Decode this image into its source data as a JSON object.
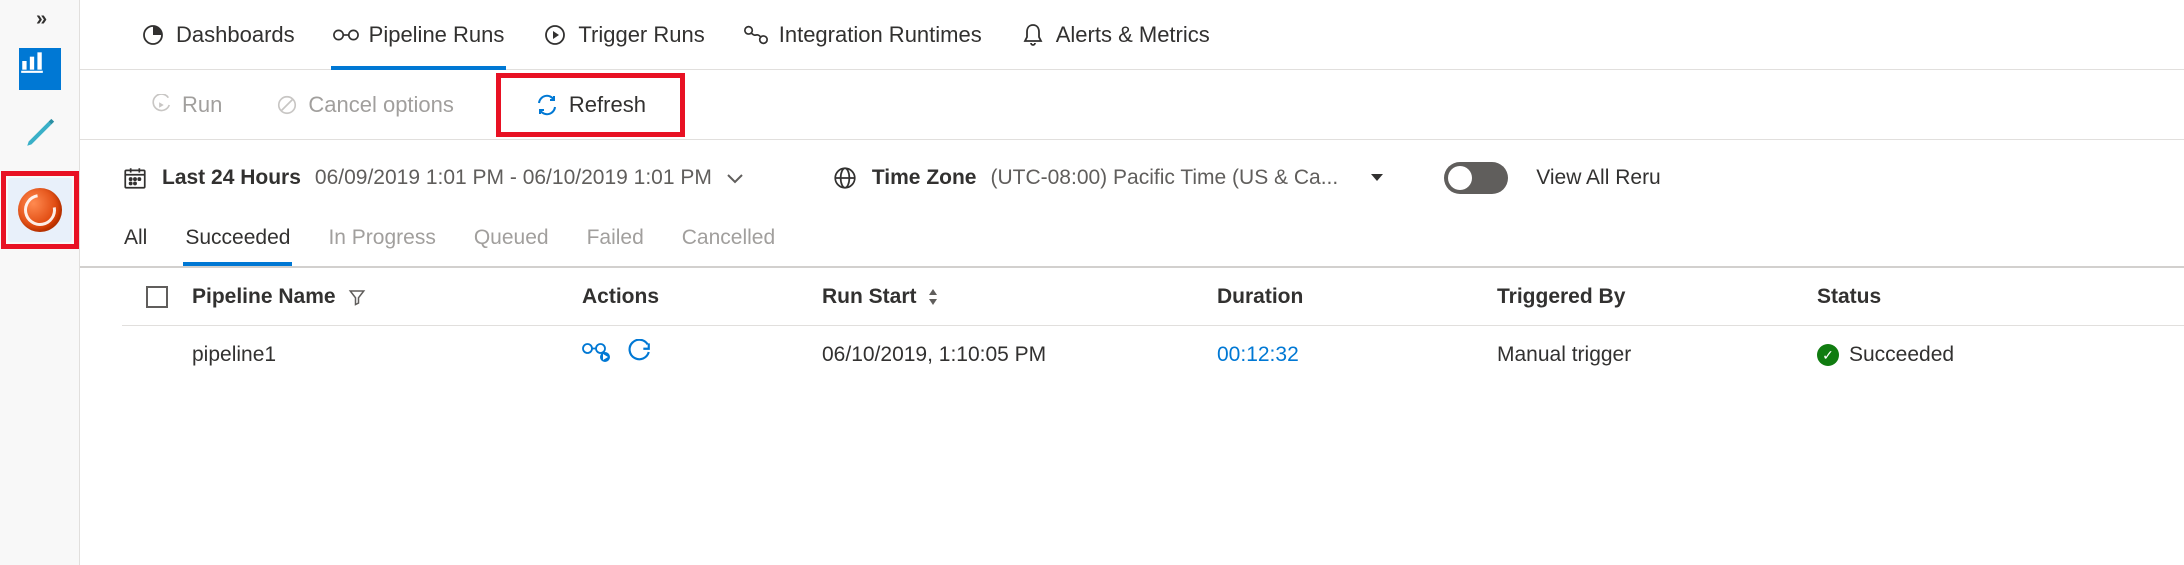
{
  "tabs": {
    "dashboards": "Dashboards",
    "pipeline_runs": "Pipeline Runs",
    "trigger_runs": "Trigger Runs",
    "integration_runtimes": "Integration Runtimes",
    "alerts_metrics": "Alerts & Metrics"
  },
  "toolbar": {
    "run": "Run",
    "cancel_options": "Cancel options",
    "refresh": "Refresh"
  },
  "filters": {
    "range_label": "Last 24 Hours",
    "range_value": "06/09/2019 1:01 PM - 06/10/2019 1:01 PM",
    "timezone_label": "Time Zone",
    "timezone_value": "(UTC-08:00) Pacific Time (US & Ca...",
    "view_all": "View All Reru"
  },
  "status_tabs": {
    "all": "All",
    "succeeded": "Succeeded",
    "in_progress": "In Progress",
    "queued": "Queued",
    "failed": "Failed",
    "cancelled": "Cancelled"
  },
  "columns": {
    "pipeline_name": "Pipeline Name",
    "actions": "Actions",
    "run_start": "Run Start",
    "duration": "Duration",
    "triggered_by": "Triggered By",
    "status": "Status"
  },
  "rows": [
    {
      "name": "pipeline1",
      "run_start": "06/10/2019, 1:10:05 PM",
      "duration": "00:12:32",
      "triggered_by": "Manual trigger",
      "status": "Succeeded"
    }
  ]
}
